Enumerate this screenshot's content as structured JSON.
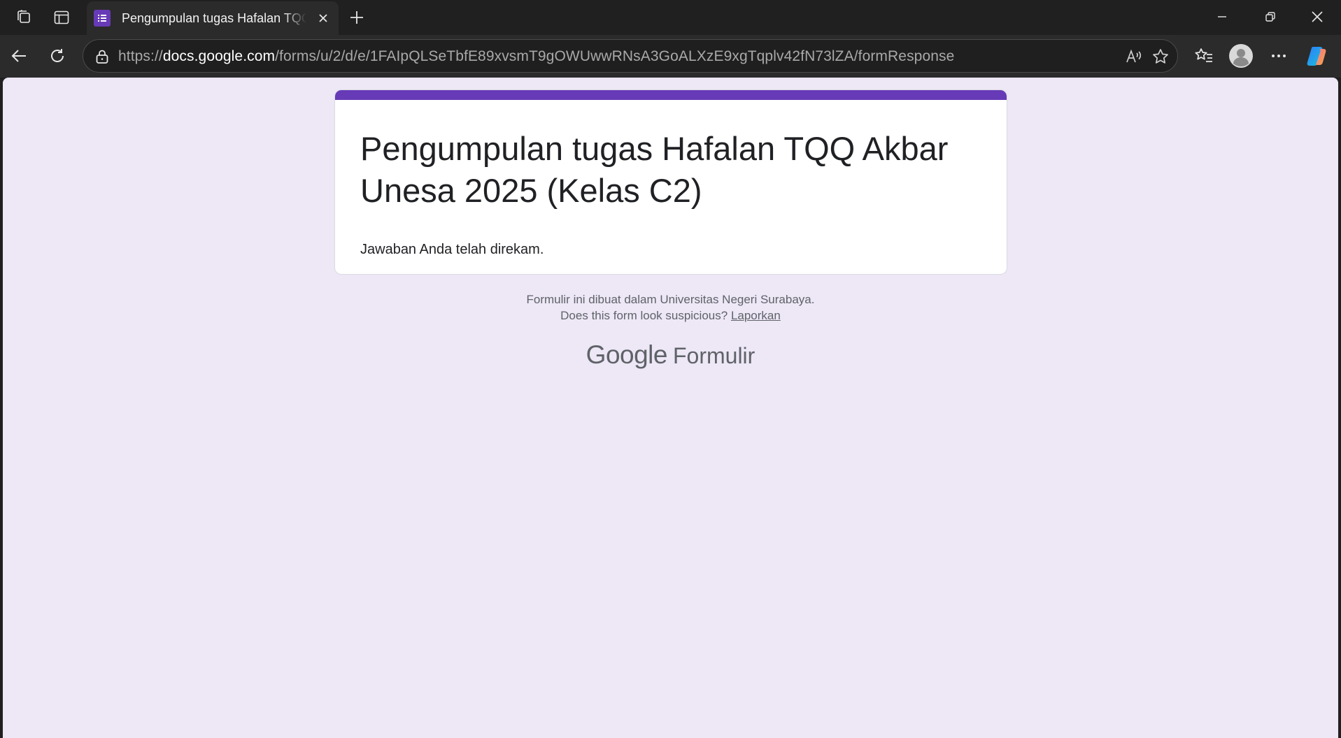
{
  "browser": {
    "tab": {
      "title": "Pengumpulan tugas Hafalan TQQ Akbar Unesa 2025 (Kelas C2)"
    },
    "address": {
      "scheme": "https://",
      "host": "docs.google.com",
      "path": "/forms/u/2/d/e/1FAIpQLSeTbfE89xvsmT9gOWUwwRNsA3GoALXzE9xgTqplv42fN73lZA/formResponse"
    },
    "icons": {
      "workspaces": "workspaces-icon",
      "vertical_tabs": "vertical-tabs-icon",
      "new_tab": "plus-icon",
      "back": "back-arrow-icon",
      "refresh": "refresh-icon",
      "lock": "lock-icon",
      "read_aloud": "read-aloud-icon",
      "favorite": "star-icon",
      "favorites": "favorites-icon",
      "profile": "avatar-icon",
      "more": "ellipsis-icon",
      "copilot": "copilot-icon"
    }
  },
  "form": {
    "title": "Pengumpulan tugas Hafalan TQQ Akbar Unesa 2025 (Kelas C2)",
    "confirmation": "Jawaban Anda telah direkam.",
    "footer_line1": "Formulir ini dibuat dalam Universitas Negeri Surabaya.",
    "footer_question": "Does this form look suspicious?",
    "report_link": "Laporkan",
    "brand_google": "Google",
    "brand_product": "Formulir",
    "accent_color": "#673ab7",
    "background_color": "#ede7f6"
  }
}
